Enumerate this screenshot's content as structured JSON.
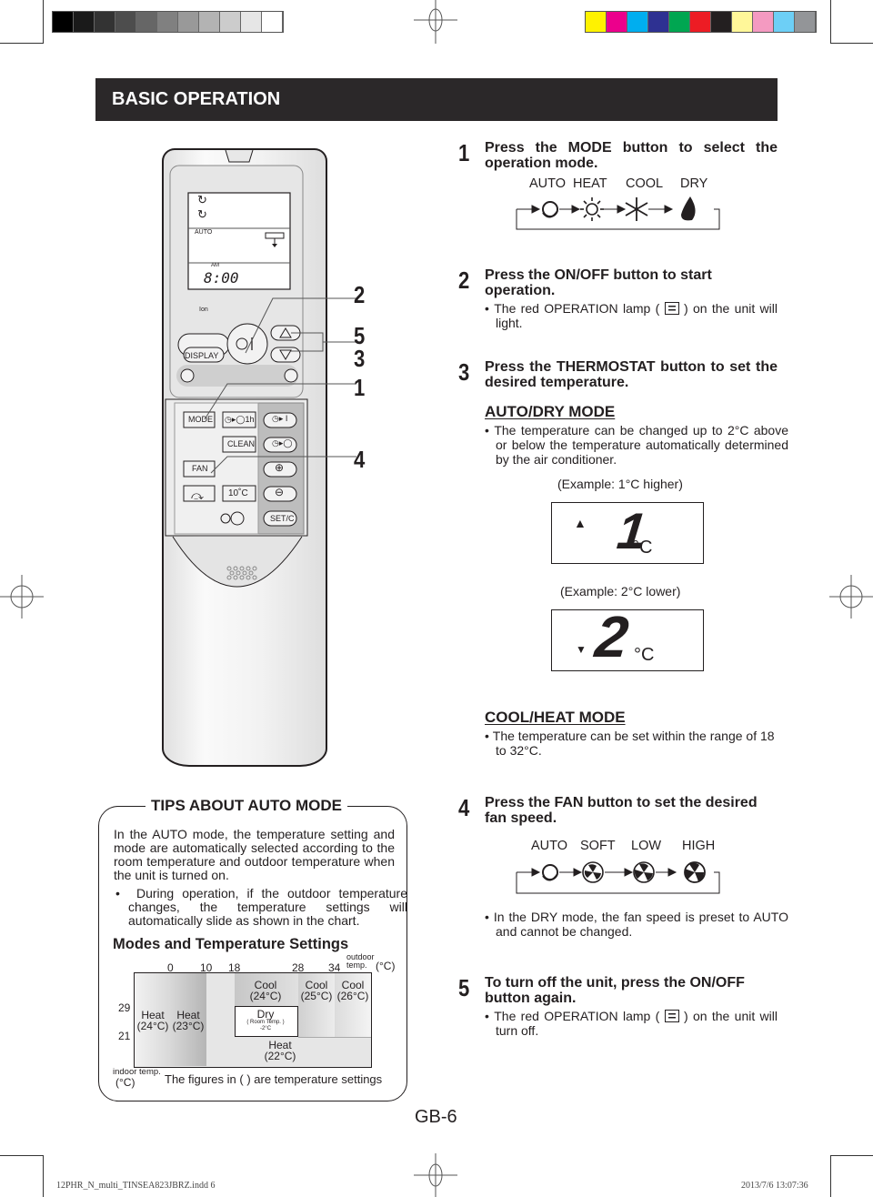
{
  "print_marks": {
    "grayscale_swatches": [
      "#000000",
      "#1a1a1a",
      "#333333",
      "#4d4d4d",
      "#666666",
      "#808080",
      "#999999",
      "#b3b3b3",
      "#cccccc",
      "#e6e6e6",
      "#ffffff"
    ],
    "color_swatches": [
      "#fff200",
      "#ec008c",
      "#00aeef",
      "#2e3192",
      "#00a651",
      "#ed1c24",
      "#231f20",
      "#fff799",
      "#f49ac1",
      "#6dcff6",
      "#939598"
    ]
  },
  "header": {
    "title": "BASIC OPERATION",
    "background": "#2b2829"
  },
  "remote": {
    "lcd_mode_label": "AUTO",
    "lcd_ampm": "AM",
    "lcd_time": "8:00",
    "ion_label": "Ion",
    "buttons": {
      "display": "DISPLAY",
      "mode": "MODE",
      "timer_1h": "◷▸◯1h",
      "clean": "CLEAN",
      "fan": "FAN",
      "ten_c": "10˚C",
      "setc": "SET/C",
      "plus": "⊕",
      "minus": "⊖",
      "on_timer": "◷▸ I",
      "off_timer": "◷▸◯"
    },
    "callouts": [
      "2",
      "5",
      "3",
      "1",
      "4"
    ]
  },
  "steps": [
    {
      "num": "1",
      "title": "Press the MODE button to select the operation mode.",
      "cycle_labels": [
        "AUTO",
        "HEAT",
        "COOL",
        "DRY"
      ],
      "cycle_icons": [
        "auto-icon",
        "heat-sun-icon",
        "cool-snowflake-icon",
        "dry-drop-icon"
      ]
    },
    {
      "num": "2",
      "title": "Press the ON/OFF button to start operation.",
      "bullet_pre": "The red OPERATION lamp (",
      "bullet_post": ") on the unit will light."
    },
    {
      "num": "3",
      "title": "Press the THERMOSTAT button to set the desired temperature.",
      "auto_dry": {
        "heading": "AUTO/DRY MODE",
        "bullet": "The temperature can be changed up to 2°C above or below the temperature automatically determined by the air conditioner.",
        "example1_caption": "(Example: 1°C higher)",
        "example1_digit": "1",
        "example1_unit": "°C",
        "example2_caption": "(Example: 2°C lower)",
        "example2_digit": "2",
        "example2_unit": "°C"
      },
      "cool_heat": {
        "heading": "COOL/HEAT MODE",
        "bullet": "The temperature can be set within the range of 18 to 32°C."
      }
    },
    {
      "num": "4",
      "title": "Press the FAN button to set the desired fan speed.",
      "cycle_labels": [
        "AUTO",
        "SOFT",
        "LOW",
        "HIGH"
      ],
      "cycle_icons": [
        "auto-icon",
        "fan-soft-icon",
        "fan-low-icon",
        "fan-high-icon"
      ],
      "bullet": "In the DRY mode, the fan speed is preset to AUTO and cannot be changed."
    },
    {
      "num": "5",
      "title": "To turn off the unit, press the ON/OFF button again.",
      "bullet_pre": "The red OPERATION lamp (",
      "bullet_post": ") on the unit will turn off."
    }
  ],
  "tips": {
    "title": "TIPS ABOUT AUTO MODE",
    "paragraph": "In the AUTO mode, the temperature setting and mode are automatically selected according to the room temperature and outdoor temperature when the unit is turned on.",
    "bullet": "During operation, if the outdoor temperature changes, the temperature settings will automatically slide as shown in the chart.",
    "chart_title": "Modes and Temperature Settings",
    "outdoor_ticks": [
      "0",
      "10",
      "18",
      "28",
      "34"
    ],
    "outdoor_label_1": "outdoor",
    "outdoor_label_2": "temp.",
    "outdoor_unit": "(°C)",
    "indoor_ticks": [
      "29",
      "21"
    ],
    "indoor_label": "indoor temp.",
    "indoor_unit": "(°C)",
    "caption": "The figures in (  ) are temperature settings",
    "regions": {
      "heat24": [
        "Heat",
        "(24°C)"
      ],
      "heat23": [
        "Heat",
        "(23°C)"
      ],
      "cool24": [
        "Cool",
        "(24°C)"
      ],
      "cool25": [
        "Cool",
        "(25°C)"
      ],
      "cool26": [
        "Cool",
        "(26°C)"
      ],
      "dry": [
        "Dry",
        "Room Temp.",
        "-2°C"
      ],
      "heat22": [
        "Heat",
        "(22°C)"
      ]
    }
  },
  "page_number": "GB-6",
  "footer": {
    "file": "12PHR_N_multi_TINSEA823JBRZ.indd   6",
    "timestamp": "2013/7/6   13:07:36"
  }
}
